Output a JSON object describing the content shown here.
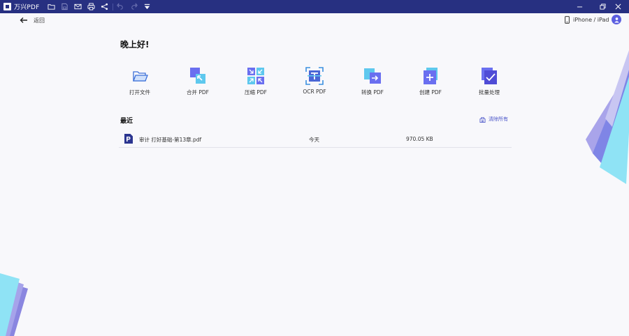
{
  "app": {
    "name": "万兴PDF"
  },
  "nav": {
    "back_label": "返回",
    "device_label": "iPhone / iPad"
  },
  "greeting": "晚上好!",
  "actions": [
    {
      "label": "打开文件",
      "icon": "open-folder-icon"
    },
    {
      "label": "合并 PDF",
      "icon": "merge-icon"
    },
    {
      "label": "压缩 PDF",
      "icon": "compress-icon"
    },
    {
      "label": "OCR PDF",
      "icon": "ocr-icon"
    },
    {
      "label": "转换 PDF",
      "icon": "convert-icon"
    },
    {
      "label": "创建 PDF",
      "icon": "create-icon"
    },
    {
      "label": "批量处理",
      "icon": "batch-icon"
    }
  ],
  "recent": {
    "title": "最近",
    "clear_label": "清除所有",
    "files": [
      {
        "name": "审计 打好基础-第13章.pdf",
        "date": "今天",
        "size": "970.05 KB"
      }
    ]
  },
  "colors": {
    "titlebar": "#273081",
    "accent": "#4a55c8",
    "background": "#f8f8fb"
  }
}
